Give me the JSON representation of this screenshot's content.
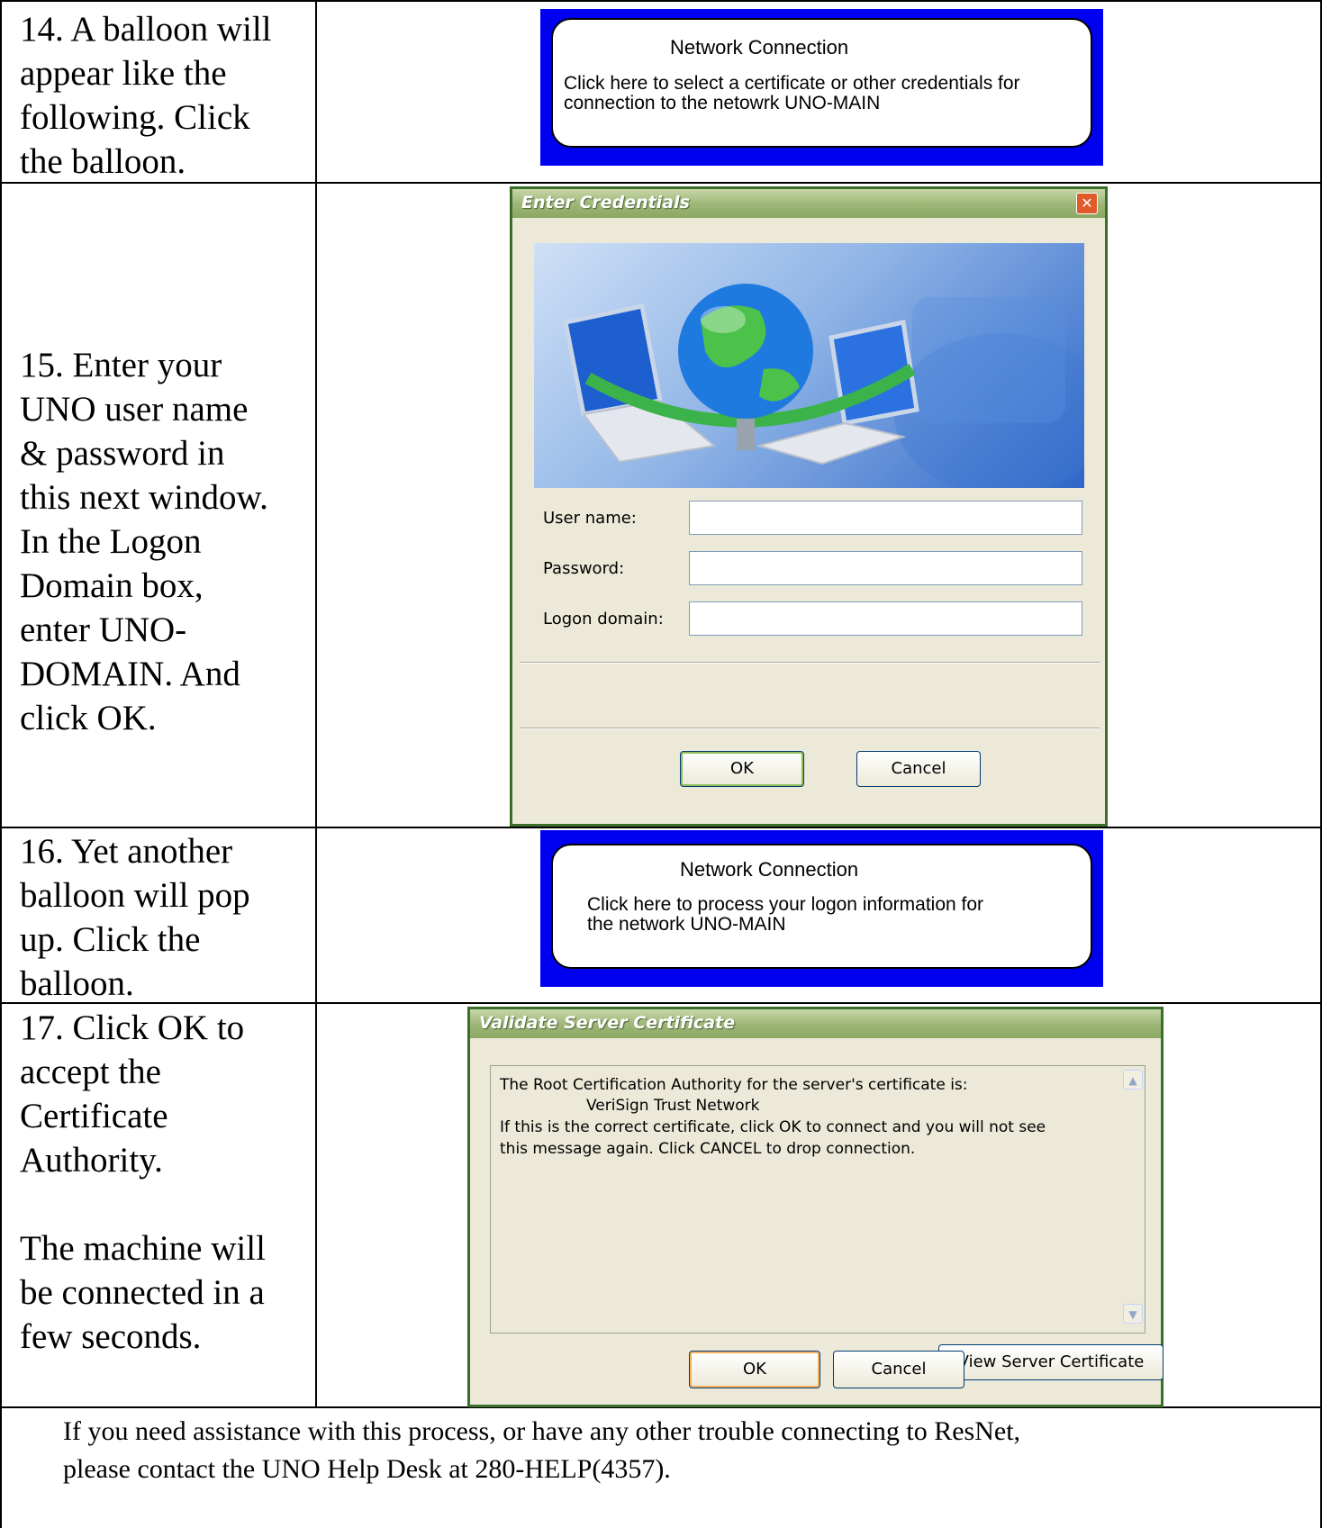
{
  "steps": [
    {
      "text": "14. A balloon will\nappear like the\nfollowing. Click\nthe balloon."
    },
    {
      "text": "15. Enter your\nUNO user name\n& password in\nthis next window.\nIn the Logon\nDomain box,\nenter UNO-\nDOMAIN. And\nclick OK."
    },
    {
      "text": "16. Yet another\nballoon will pop\nup. Click the\nballoon."
    },
    {
      "text": "17. Click OK to\naccept the\nCertificate\nAuthority.\n\nThe machine will\nbe connected in a\nfew seconds."
    }
  ],
  "balloon1": {
    "title": "Network Connection",
    "message": "Click here to select a certificate or other credentials for\nconnection to the netowrk UNO-MAIN"
  },
  "credentials_dialog": {
    "title": "Enter Credentials",
    "user_label": "User name:",
    "password_label": "Password:",
    "domain_label": "Logon domain:",
    "user_value": "",
    "password_value": "",
    "domain_value": "",
    "ok_label": "OK",
    "cancel_label": "Cancel"
  },
  "balloon2": {
    "title": "Network Connection",
    "message": "Click here to process your logon information for\nthe network UNO-MAIN"
  },
  "certificate_dialog": {
    "title": "Validate Server Certificate",
    "line1": "The Root Certification Authority for the server's certificate is:",
    "line2": "VeriSign Trust Network",
    "line3": "If this is the correct certificate, click OK to connect and you will not see",
    "line4": "this message again.  Click CANCEL to drop connection.",
    "view_cert_label": "View Server Certificate",
    "ok_label": "OK",
    "cancel_label": "Cancel"
  },
  "footer": {
    "line1": "If you need assistance with this process, or have any other trouble connecting to ResNet,",
    "line2": "please contact the UNO Help Desk at 280-HELP(4357)."
  },
  "colors": {
    "balloon_background": "#0000f0",
    "xp_dialog_face": "#ece9d8",
    "xp_titlebar": "#9fb879"
  }
}
